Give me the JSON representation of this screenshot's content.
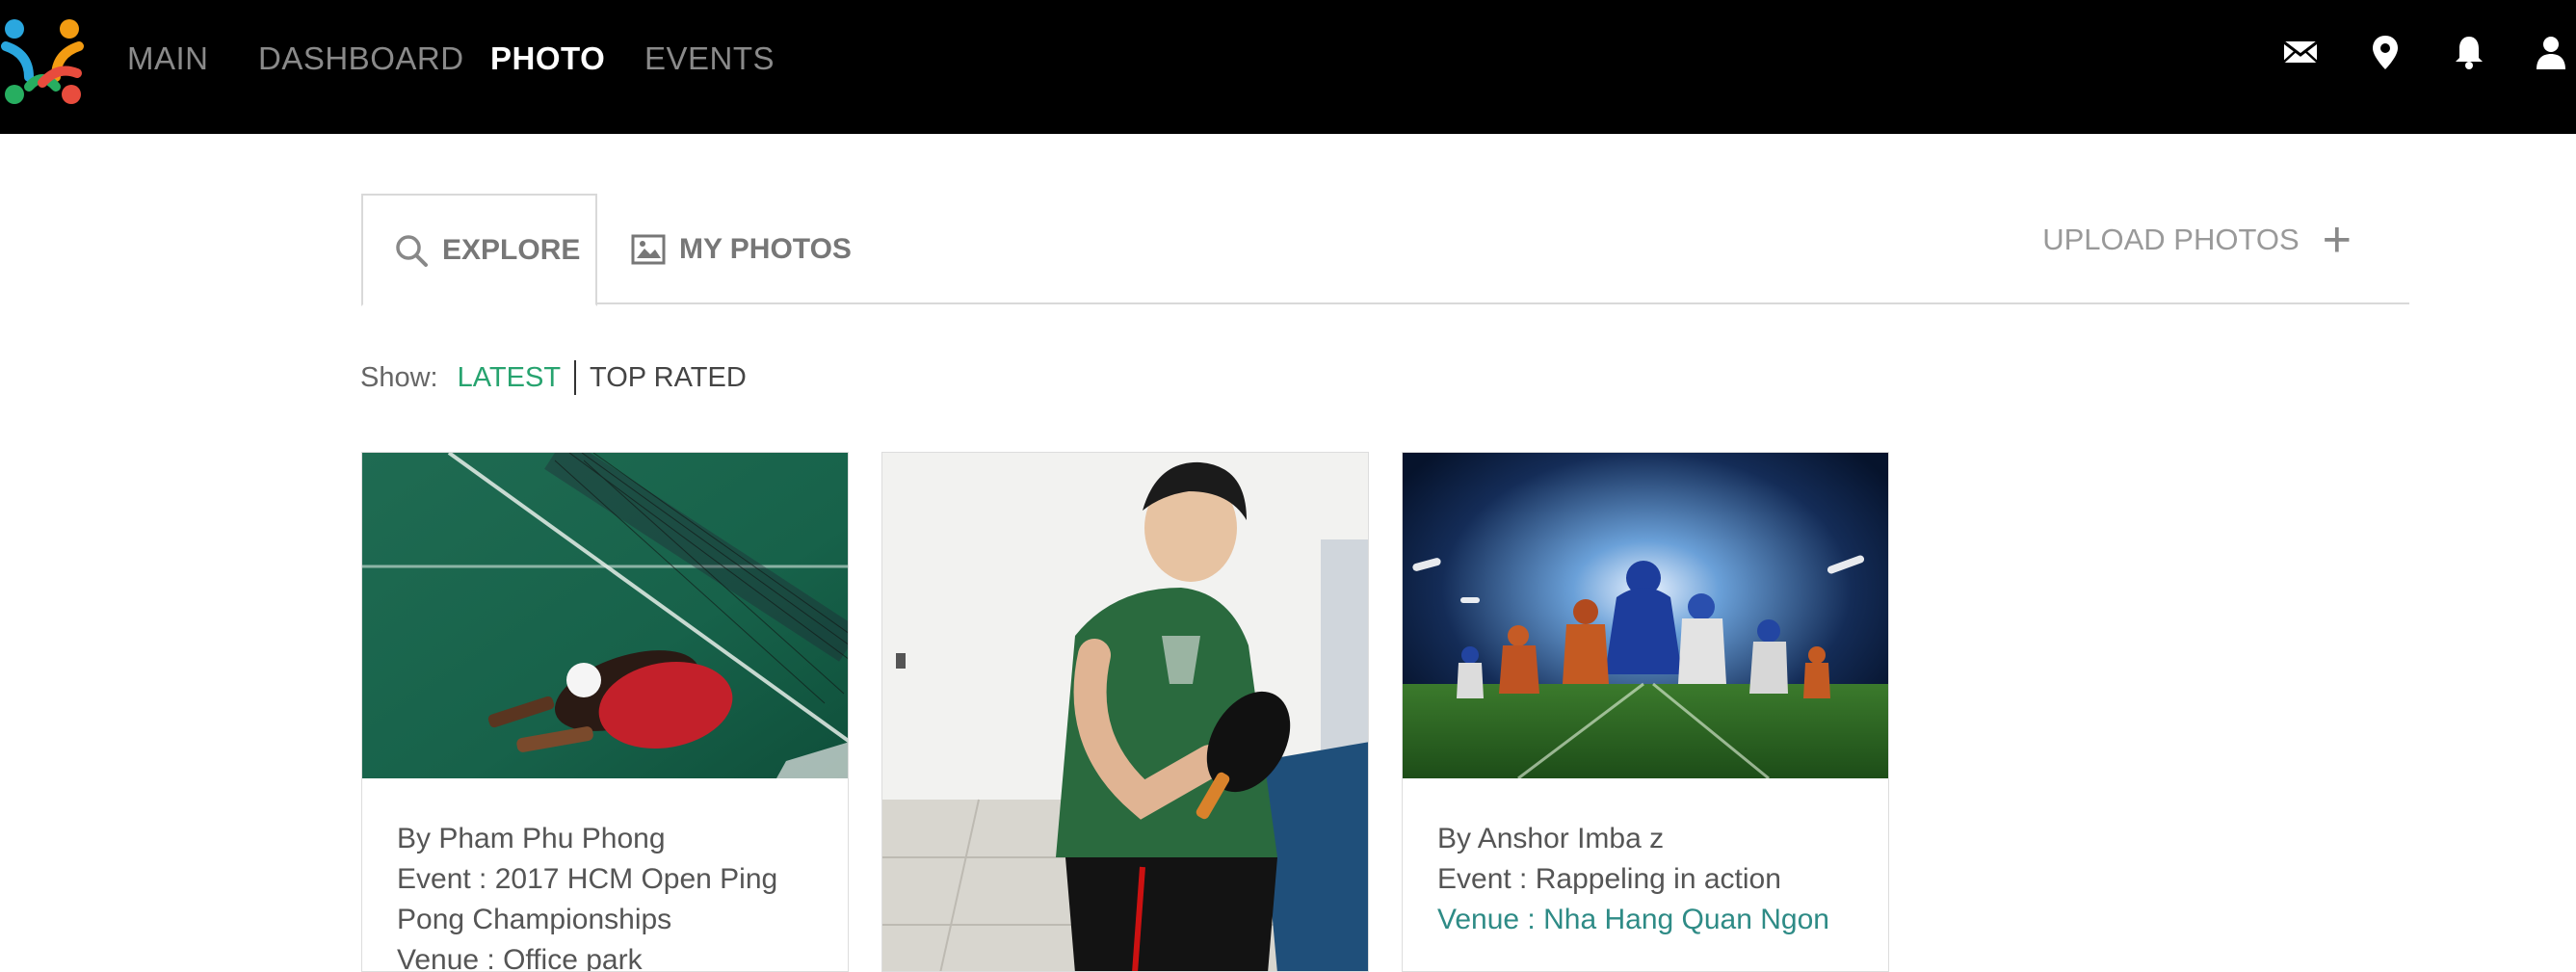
{
  "nav": {
    "items": [
      {
        "label": "MAIN",
        "active": false
      },
      {
        "label": "DASHBOARD",
        "active": false
      },
      {
        "label": "PHOTO",
        "active": true
      },
      {
        "label": "EVENTS",
        "active": false
      }
    ],
    "icons": [
      "mail-icon",
      "location-pin-icon",
      "bell-icon",
      "user-icon"
    ]
  },
  "tabs": {
    "explore": "EXPLORE",
    "my_photos": "MY PHOTOS",
    "upload": "UPLOAD PHOTOS"
  },
  "filter": {
    "label": "Show:",
    "latest": "LATEST",
    "top_rated": "TOP RATED",
    "selected": "LATEST"
  },
  "cards": [
    {
      "by": "By Pham Phu Phong",
      "event": "Event : 2017 HCM Open Ping Pong Championships",
      "venue": "Venue : Office park"
    },
    {
      "by": "",
      "event": "",
      "venue": ""
    },
    {
      "by": "By Anshor Imba z",
      "event": "Event : Rappeling in action",
      "venue": "Venue : Nha Hang Quan Ngon"
    }
  ],
  "colors": {
    "navbar_bg": "#000000",
    "accent_green": "#27a36f",
    "venue_teal": "#2e8b86",
    "logo": [
      "#e84c3d",
      "#f39c12",
      "#27ae60",
      "#2aa7df"
    ]
  }
}
